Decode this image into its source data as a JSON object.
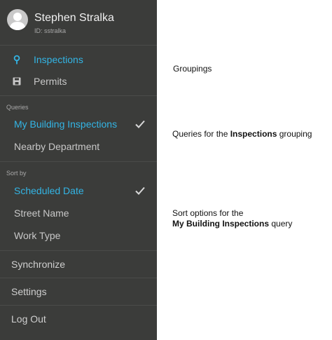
{
  "profile": {
    "name": "Stephen Stralka",
    "id_text": "ID: sstralka"
  },
  "groupings": [
    {
      "label": "Inspections",
      "icon": "location-pin-icon",
      "active": true
    },
    {
      "label": "Permits",
      "icon": "floppy-disk-icon",
      "active": false
    }
  ],
  "queries": {
    "title": "Queries",
    "items": [
      {
        "label": "My Building Inspections",
        "selected": true
      },
      {
        "label": "Nearby Department",
        "selected": false
      }
    ]
  },
  "sort": {
    "title": "Sort by",
    "items": [
      {
        "label": "Scheduled Date",
        "selected": true
      },
      {
        "label": "Street Name",
        "selected": false
      },
      {
        "label": "Work Type",
        "selected": false
      }
    ]
  },
  "actions": [
    {
      "label": "Synchronize"
    },
    {
      "label": "Settings"
    },
    {
      "label": "Log Out"
    }
  ],
  "annotations": {
    "groupings": "Groupings",
    "queries_prefix": "Queries for the ",
    "queries_bold": "Inspections",
    "queries_suffix": " grouping",
    "sort_line1": "Sort options for the",
    "sort_bold": "My Building Inspections",
    "sort_suffix": " query"
  },
  "colors": {
    "drawer_bg": "#3b3c3a",
    "accent": "#33b5e5",
    "text": "#c8c8c8"
  }
}
